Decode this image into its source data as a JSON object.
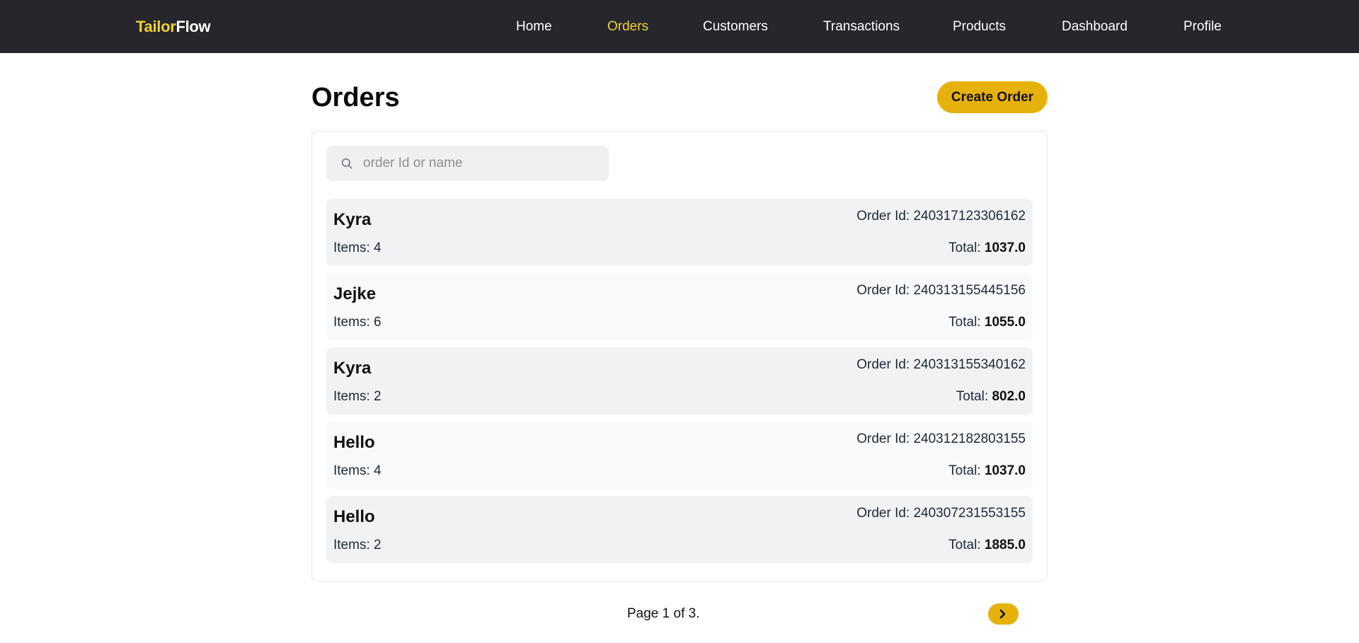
{
  "brand": {
    "part1": "Tailor",
    "part2": "Flow",
    "accent_color": "#f2cf35"
  },
  "nav": {
    "items": [
      {
        "label": "Home"
      },
      {
        "label": "Orders",
        "active": true
      },
      {
        "label": "Customers"
      },
      {
        "label": "Transactions"
      },
      {
        "label": "Products"
      },
      {
        "label": "Dashboard"
      },
      {
        "label": "Profile"
      }
    ]
  },
  "page": {
    "title": "Orders",
    "create_button": "Create Order"
  },
  "search": {
    "placeholder": "order Id or name",
    "value": "",
    "icon": "search-icon"
  },
  "orders": [
    {
      "name": "Kyra",
      "order_id_label": "Order Id: 240317123306162",
      "items_label": "Items: 4",
      "total_label": "Total: ",
      "total_value": "1037.0"
    },
    {
      "name": "Jejke",
      "order_id_label": "Order Id: 240313155445156",
      "items_label": "Items: 6",
      "total_label": "Total: ",
      "total_value": "1055.0"
    },
    {
      "name": "Kyra",
      "order_id_label": "Order Id: 240313155340162",
      "items_label": "Items: 2",
      "total_label": "Total: ",
      "total_value": "802.0"
    },
    {
      "name": "Hello",
      "order_id_label": "Order Id: 240312182803155",
      "items_label": "Items: 4",
      "total_label": "Total: ",
      "total_value": "1037.0"
    },
    {
      "name": "Hello",
      "order_id_label": "Order Id: 240307231553155",
      "items_label": "Items: 2",
      "total_label": "Total: ",
      "total_value": "1885.0"
    }
  ],
  "pagination": {
    "text": "Page 1 of 3.",
    "current_page": 1,
    "total_pages": 3,
    "next_icon": "chevron-right-icon"
  },
  "colors": {
    "navbar": "#25272c",
    "accent_button": "#e7b10c",
    "row_dark": "#f1f2f4",
    "row_light": "#f8f9fa"
  }
}
